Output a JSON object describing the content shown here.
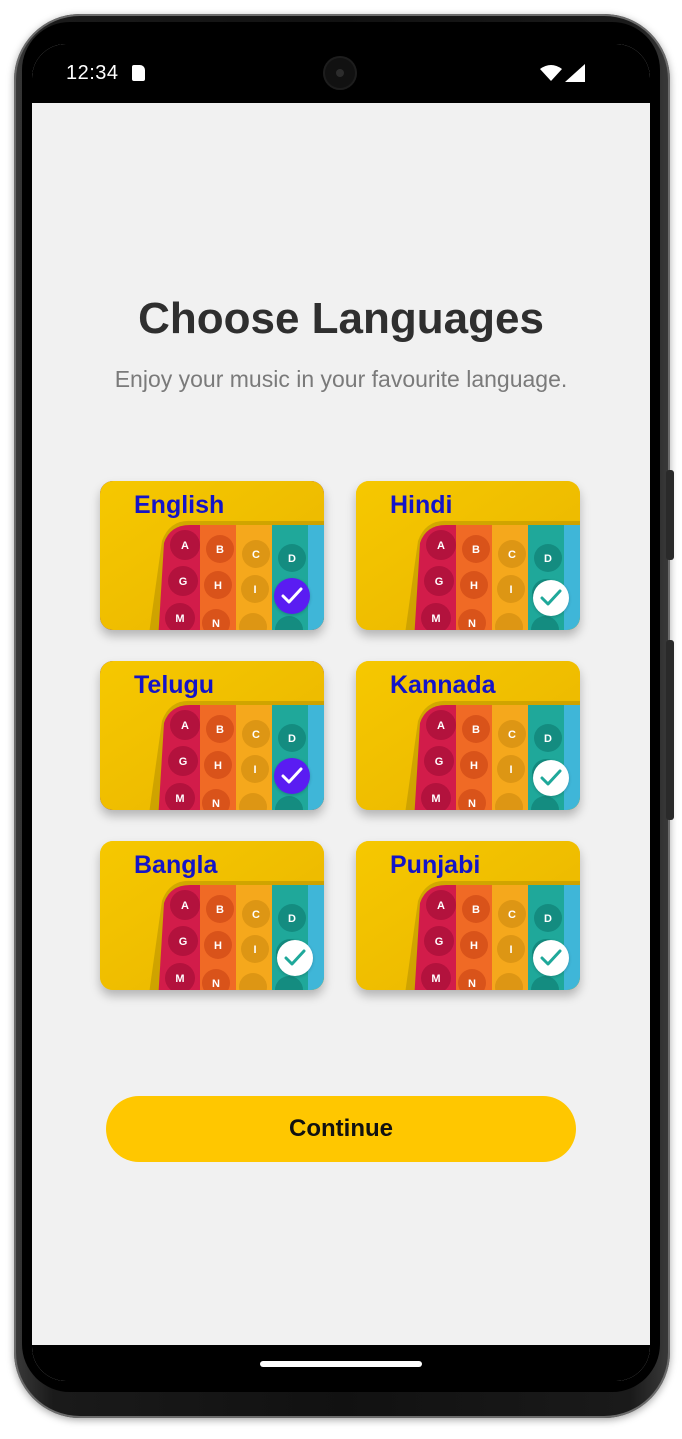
{
  "status_bar": {
    "time": "12:34",
    "icons": [
      "sd-card-icon",
      "wifi-icon",
      "signal-icon"
    ]
  },
  "header": {
    "title": "Choose Languages",
    "subtitle": "Enjoy your music in your favourite language."
  },
  "languages": [
    {
      "label": "English",
      "selected": true
    },
    {
      "label": "Hindi",
      "selected": false
    },
    {
      "label": "Telugu",
      "selected": true
    },
    {
      "label": "Kannada",
      "selected": false
    },
    {
      "label": "Bangla",
      "selected": false
    },
    {
      "label": "Punjabi",
      "selected": false
    }
  ],
  "continue_button": {
    "label": "Continue"
  },
  "colors": {
    "accent": "#5a1cf2",
    "button": "#ffc700",
    "label": "#1414c8",
    "background": "#f1f1f1"
  }
}
